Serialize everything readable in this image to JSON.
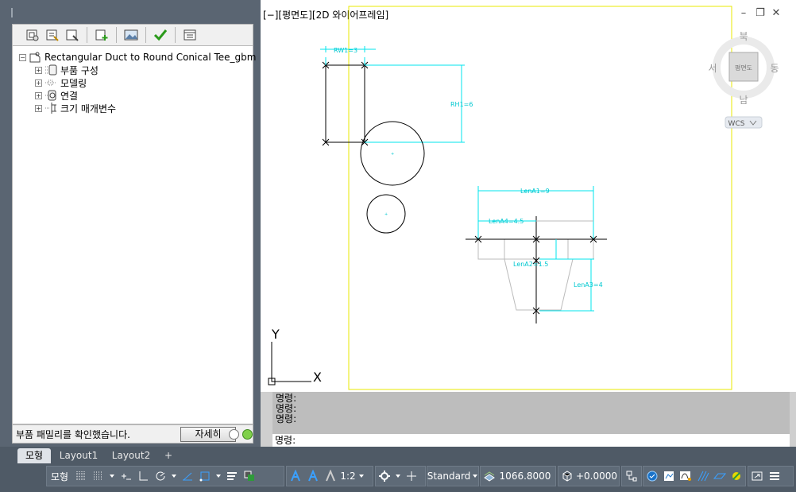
{
  "palette": {
    "toolbar_icons": [
      "new-part-icon",
      "open-part-icon",
      "save-part-icon",
      "add-icon",
      "image-icon",
      "check-icon",
      "properties-icon"
    ],
    "tree": {
      "root": "Rectangular Duct to Round Conical Tee_gbm",
      "children": [
        {
          "label": "부품 구성",
          "icon": "part-config-icon"
        },
        {
          "label": "모델링",
          "icon": "modeling-icon"
        },
        {
          "label": "연결",
          "icon": "connection-icon"
        },
        {
          "label": "크기 매개변수",
          "icon": "size-params-icon"
        }
      ]
    },
    "status_text": "부품 패밀리를 확인했습니다.",
    "detail_button": "자세히"
  },
  "viewport": {
    "label": "[−][평면도][2D 와이어프레임]",
    "viewcube": {
      "north": "북",
      "south": "남",
      "east": "동",
      "west": "서",
      "face": "평면도",
      "wcs": "WCS"
    },
    "ucs": {
      "x": "X",
      "y": "Y"
    },
    "dims": {
      "rw1": "RW1=3",
      "rh1": "RH1=6",
      "lena1": "LenA1=9",
      "lena4": "LenA4=4.5",
      "lena3": "LenA3=4",
      "lena2": "LenA2=1.5"
    }
  },
  "command": {
    "history": [
      "명령:",
      "명령:",
      "명령:"
    ],
    "prompt": "명령:"
  },
  "tabs": [
    "모형",
    "Layout1",
    "Layout2",
    "+"
  ],
  "statusbar": {
    "model": "모형",
    "scale": "1:2",
    "style": "Standard",
    "elevation": "1066.8000",
    "offset": "+0.0000"
  },
  "colors": {
    "dimension": "#00e5ee",
    "boundary": "#ffff00",
    "geometry": "#000000",
    "accent_blue": "#1a73c9"
  }
}
